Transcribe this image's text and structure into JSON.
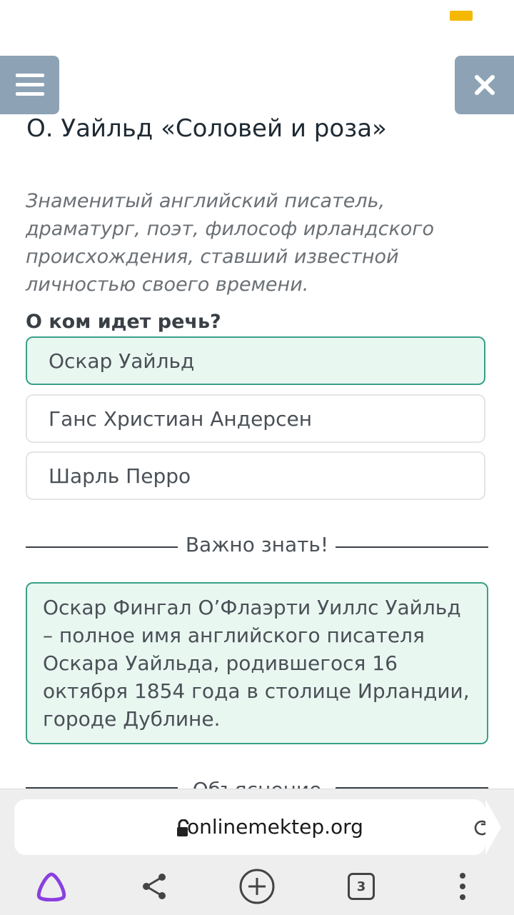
{
  "header": {
    "menu_icon": "hamburger-icon",
    "close_icon": "close-icon",
    "accent_color": "#f5b800",
    "button_color": "#8da3b5"
  },
  "lesson": {
    "title": "О. Уайльд «Соловей и роза»",
    "description": "Знаменитый английский писатель, драматург, поэт, философ ирландского происхождения, ставший известной личностью своего времени.",
    "question": "О ком идет речь?",
    "options": [
      {
        "label": "Оскар Уайльд",
        "selected": true
      },
      {
        "label": "Ганс Христиан Андерсен",
        "selected": false
      },
      {
        "label": "Шарль Перро",
        "selected": false
      }
    ]
  },
  "important": {
    "heading": "Важно знать!",
    "text": "Оскар Фингал О’Флаэрти Уиллс Уайльд – полное имя английского писателя Оскара Уайльда, родившегося 16 октября 1854 года в столице Ирландии, городе Дублине."
  },
  "explanation": {
    "heading": "Объяснение"
  },
  "browser": {
    "url": "onlinemektep.org",
    "tabs_count": "3",
    "icons": [
      "lock-icon",
      "reload-icon",
      "alice-icon",
      "share-icon",
      "new-tab-icon",
      "tabs-icon",
      "more-icon"
    ],
    "accent_color": "#8a3fe0"
  }
}
